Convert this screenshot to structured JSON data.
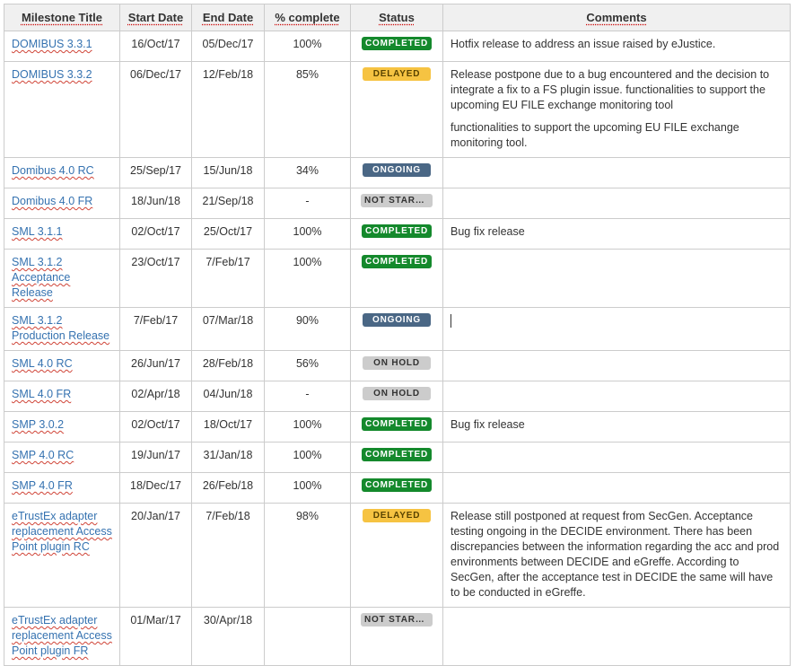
{
  "headers": [
    "Milestone Title",
    "Start Date",
    "End Date",
    "% complete",
    "Status",
    "Comments"
  ],
  "rows": [
    {
      "title": "DOMIBUS 3.3.1",
      "start": "16/Oct/17",
      "end": "05/Dec/17",
      "pct": "100%",
      "status": "COMPLETED",
      "status_kind": "completed",
      "comments": [
        "Hotfix release to address an issue raised by eJustice."
      ]
    },
    {
      "title": "DOMIBUS 3.3.2",
      "start": "06/Dec/17",
      "end": "12/Feb/18",
      "pct": "85%",
      "status": "DELAYED",
      "status_kind": "delayed",
      "comments": [
        "Release postpone due to a bug encountered and the decision to integrate a fix to a FS plugin issue. functionalities to support the upcoming EU FILE exchange monitoring tool",
        "functionalities to support the upcoming EU FILE exchange monitoring tool."
      ]
    },
    {
      "title": "Domibus 4.0 RC",
      "start": "25/Sep/17",
      "end": "15/Jun/18",
      "pct": "34%",
      "status": "ONGOING",
      "status_kind": "ongoing",
      "comments": []
    },
    {
      "title": "Domibus 4.0 FR",
      "start": "18/Jun/18",
      "end": "21/Sep/18",
      "pct": "-",
      "status": "NOT STARTED",
      "status_kind": "notstarted",
      "comments": []
    },
    {
      "title": "SML 3.1.1",
      "start": "02/Oct/17",
      "end": "25/Oct/17",
      "pct": "100%",
      "status": "COMPLETED",
      "status_kind": "completed",
      "comments": [
        "Bug fix release"
      ]
    },
    {
      "title": "SML 3.1.2 Acceptance Release",
      "start": "23/Oct/17",
      "end": "7/Feb/17",
      "pct": "100%",
      "status": "COMPLETED",
      "status_kind": "completed",
      "comments": []
    },
    {
      "title": "SML 3.1.2 Production Release",
      "start": "7/Feb/17",
      "end": "07/Mar/18",
      "pct": "90%",
      "status": "ONGOING",
      "status_kind": "ongoing",
      "comments": [],
      "cursor": true
    },
    {
      "title": "SML 4.0 RC",
      "start": "26/Jun/17",
      "end": "28/Feb/18",
      "pct": "56%",
      "status": "ON HOLD",
      "status_kind": "onhold",
      "comments": []
    },
    {
      "title": "SML 4.0 FR",
      "start": "02/Apr/18",
      "end": "04/Jun/18",
      "pct": "-",
      "status": "ON HOLD",
      "status_kind": "onhold",
      "comments": []
    },
    {
      "title": "SMP 3.0.2",
      "start": "02/Oct/17",
      "end": "18/Oct/17",
      "pct": "100%",
      "status": "COMPLETED",
      "status_kind": "completed",
      "comments": [
        "Bug fix release"
      ]
    },
    {
      "title": "SMP 4.0 RC",
      "start": "19/Jun/17",
      "end": "31/Jan/18",
      "pct": "100%",
      "status": "COMPLETED",
      "status_kind": "completed",
      "comments": []
    },
    {
      "title": "SMP 4.0 FR",
      "start": "18/Dec/17",
      "end": "26/Feb/18",
      "pct": "100%",
      "status": "COMPLETED",
      "status_kind": "completed",
      "comments": []
    },
    {
      "title": "eTrustEx adapter replacement Access Point plugin RC",
      "start": "20/Jan/17",
      "end": "7/Feb/18",
      "pct": "98%",
      "status": "DELAYED",
      "status_kind": "delayed",
      "comments": [
        "Release still postponed at request from SecGen. Acceptance testing ongoing in the DECIDE environment. There has been discrepancies between the information regarding the acc and prod environments between DECIDE and eGreffe. According to SecGen, after the acceptance test in DECIDE the same will have to be conducted in eGreffe."
      ]
    },
    {
      "title": "eTrustEx adapter replacement Access Point plugin FR",
      "start": "01/Mar/17",
      "end": "30/Apr/18",
      "pct": "",
      "status": "NOT STARTED",
      "status_kind": "notstarted",
      "comments": []
    }
  ]
}
